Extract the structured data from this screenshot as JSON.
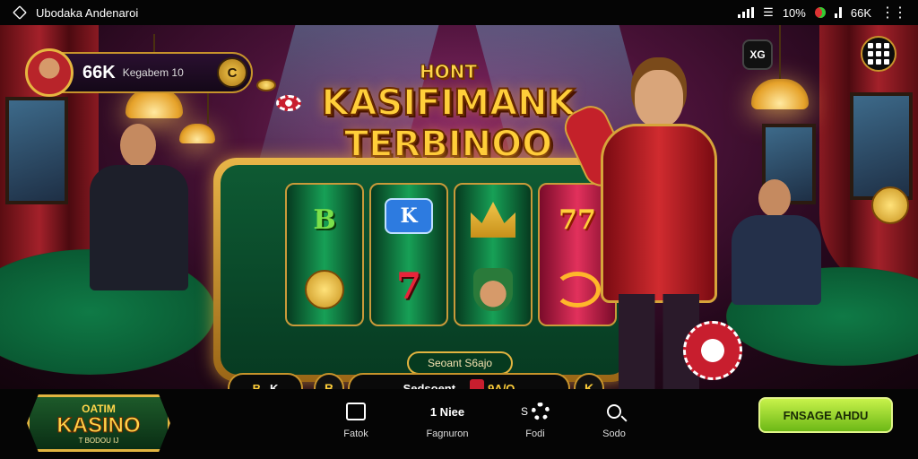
{
  "status_bar": {
    "app_name": "Ubodaka Andenaroi",
    "battery": "10%",
    "coins": "66K",
    "menu_icon": "dots-icon"
  },
  "player": {
    "coins": "66K",
    "name": "Kegabem 10",
    "badge": "C"
  },
  "top": {
    "share_label": "XG"
  },
  "title": {
    "small": "HONT",
    "line1": "KASIFIMANK",
    "line2": "TERBINOO"
  },
  "machine": {
    "plate_label": "",
    "select_label": "Seoant S6ajo",
    "reels": [
      [
        "B",
        "coins"
      ],
      [
        "K",
        "7"
      ],
      [
        "crown",
        "face"
      ],
      [
        "77",
        "horse"
      ]
    ]
  },
  "controls": {
    "bet_value": "K",
    "bet_icon": "B",
    "balance_label": "Sedsoent",
    "win_value": "9A/O",
    "right_label": "K"
  },
  "logo": {
    "line1": "OATIM",
    "line2": "KASINO",
    "line3": "T BODOU IJ"
  },
  "nav": {
    "items": [
      {
        "label": "Fatok",
        "icon": "photo-icon",
        "glyph": ""
      },
      {
        "label": "Fagnuron",
        "icon": "user-icon",
        "glyph": "1 Niee"
      },
      {
        "label": "Fodi",
        "icon": "gear-icon",
        "glyph": "S"
      },
      {
        "label": "Sodo",
        "icon": "search-icon",
        "glyph": ""
      }
    ],
    "cta_label": "FNSAGE AHDU"
  },
  "colors": {
    "gold": "#e2b440",
    "felt_green": "#0e5a33",
    "cta_green": "#8fd21e",
    "accent_red": "#c4212a"
  }
}
